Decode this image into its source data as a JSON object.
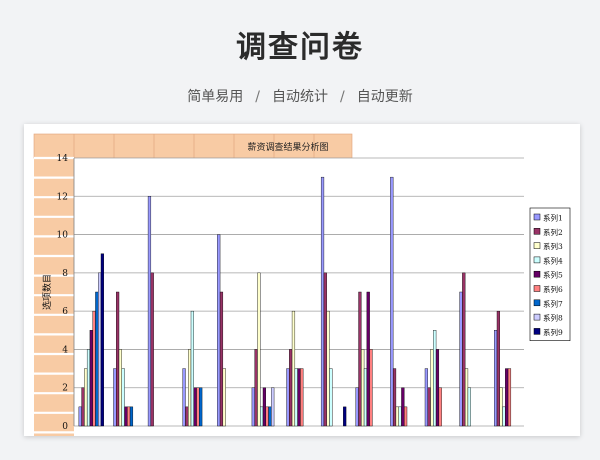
{
  "page": {
    "title": "调查问卷",
    "features": [
      "简单易用",
      "自动统计",
      "自动更新"
    ],
    "separator": "/"
  },
  "chart_data": {
    "type": "bar",
    "title": "薪资调查结果分析图",
    "ylabel": "选项数目",
    "xlabel": "",
    "ylim": [
      0,
      14
    ],
    "yticks": [
      0,
      2,
      4,
      6,
      8,
      10,
      12,
      14
    ],
    "grid": true,
    "legend_position": "right",
    "header_band_color": "#f8cba4",
    "series": [
      {
        "name": "系列1",
        "color": "#9999ff",
        "values": [
          1,
          3,
          12,
          3,
          10,
          2,
          3,
          13,
          2,
          13,
          3,
          7,
          5
        ]
      },
      {
        "name": "系列2",
        "color": "#993366",
        "values": [
          2,
          7,
          8,
          1,
          7,
          4,
          4,
          8,
          7,
          3,
          2,
          8,
          6
        ]
      },
      {
        "name": "系列3",
        "color": "#ffffcc",
        "values": [
          3,
          4,
          0,
          4,
          3,
          8,
          6,
          6,
          4,
          1,
          4,
          3,
          2
        ]
      },
      {
        "name": "系列4",
        "color": "#ccffff",
        "values": [
          4,
          3,
          0,
          6,
          0,
          1,
          3,
          3,
          3,
          1,
          5,
          2,
          1
        ]
      },
      {
        "name": "系列5",
        "color": "#660066",
        "values": [
          5,
          1,
          0,
          2,
          0,
          2,
          3,
          0,
          7,
          2,
          4,
          0,
          3
        ]
      },
      {
        "name": "系列6",
        "color": "#ff8080",
        "values": [
          6,
          1,
          0,
          2,
          0,
          1,
          3,
          0,
          4,
          1,
          2,
          0,
          3
        ]
      },
      {
        "name": "系列7",
        "color": "#0066cc",
        "values": [
          7,
          1,
          0,
          2,
          0,
          1,
          0,
          0,
          0,
          0,
          0,
          0,
          0
        ]
      },
      {
        "name": "系列8",
        "color": "#ccccff",
        "values": [
          8,
          0,
          0,
          0,
          0,
          2,
          0,
          0,
          0,
          0,
          0,
          0,
          0
        ]
      },
      {
        "name": "系列9",
        "color": "#000080",
        "values": [
          9,
          0,
          0,
          0,
          0,
          0,
          0,
          1,
          0,
          0,
          0,
          0,
          0
        ]
      }
    ]
  }
}
